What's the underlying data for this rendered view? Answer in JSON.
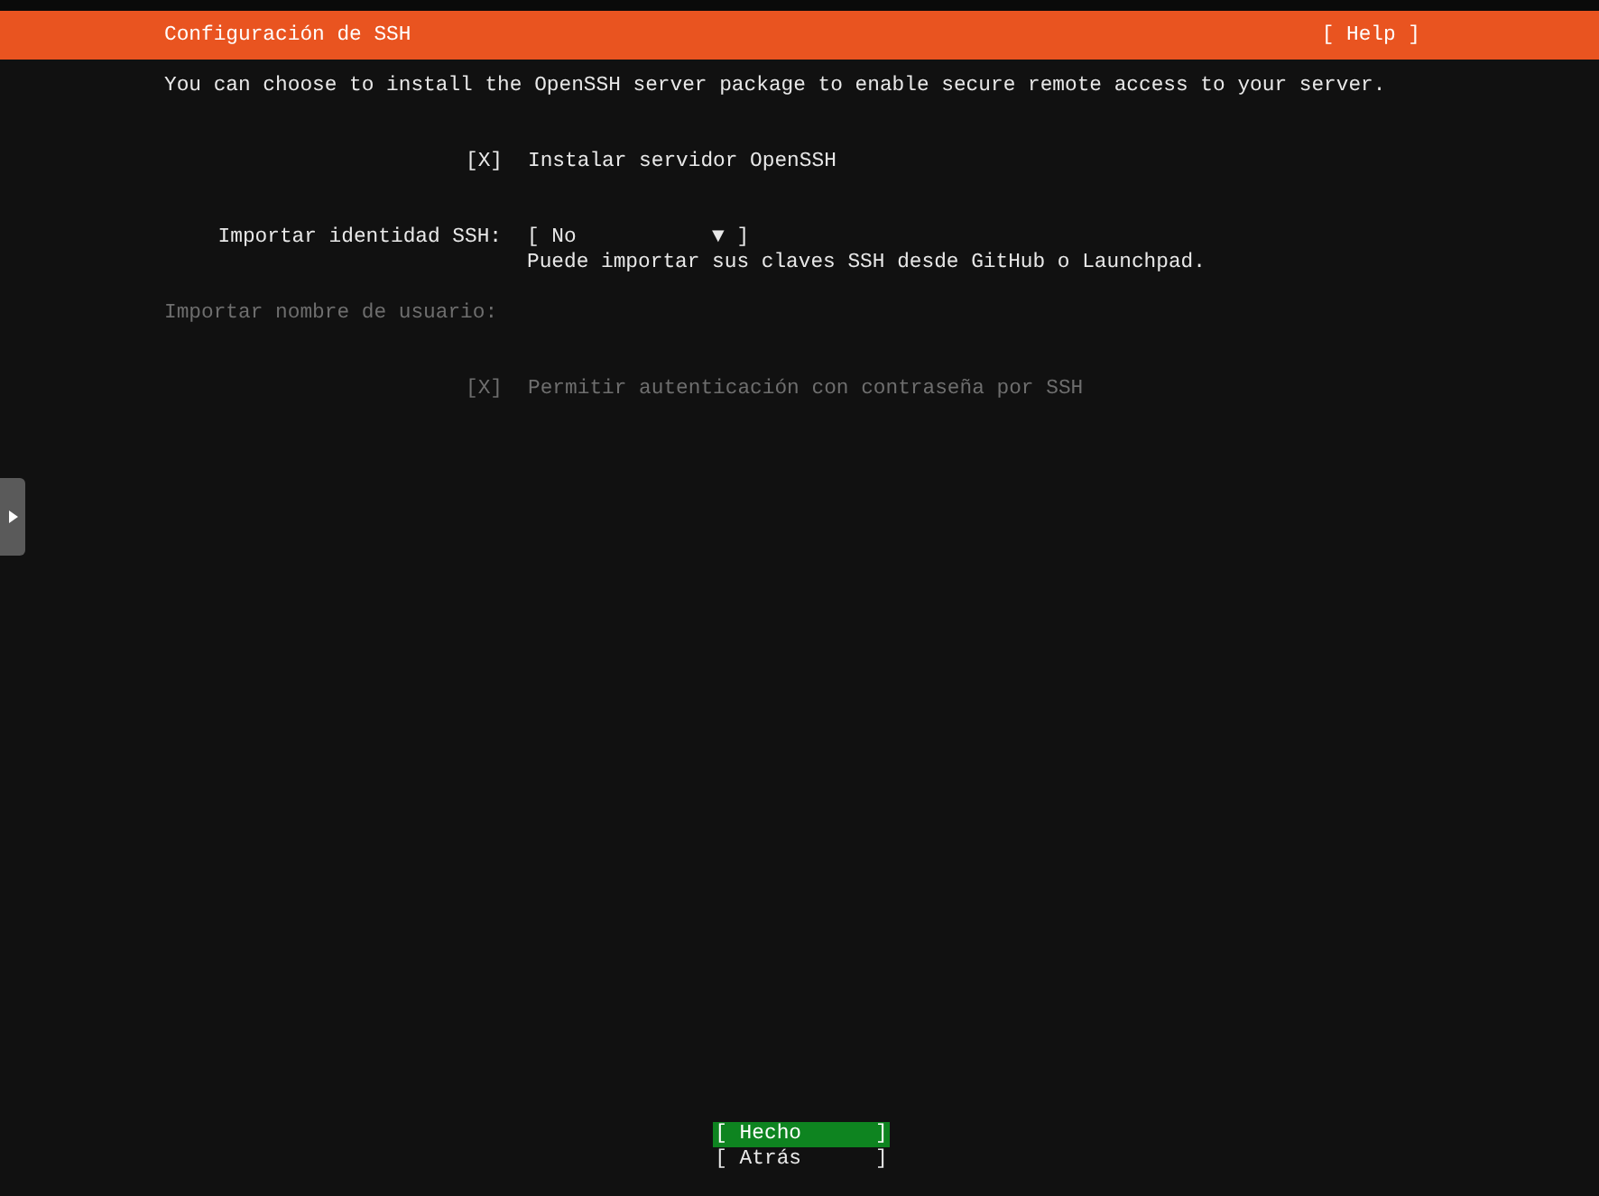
{
  "header": {
    "title": "Configuración de SSH",
    "help_button": "[ Help ]"
  },
  "intro": "You can choose to install the OpenSSH server package to enable secure remote access to your server.",
  "fields": [
    {
      "kind": "checkbox",
      "mark": "[X]",
      "label": "Instalar servidor OpenSSH",
      "disabled": false
    },
    {
      "kind": "dropdown",
      "label": "Importar identidad SSH:",
      "value": "[ No           ▼ ]",
      "hint": "Puede importar sus claves SSH desde GitHub o Launchpad.",
      "disabled": false
    },
    {
      "kind": "text",
      "label": "Importar nombre de usuario:",
      "disabled": true
    },
    {
      "kind": "checkbox",
      "mark": "[X]",
      "label": "Permitir autenticación con contraseña por SSH",
      "disabled": true
    }
  ],
  "buttons": [
    {
      "label": "[ Hecho      ]",
      "selected": true
    },
    {
      "label": "[ Atrás      ]",
      "selected": false
    }
  ]
}
